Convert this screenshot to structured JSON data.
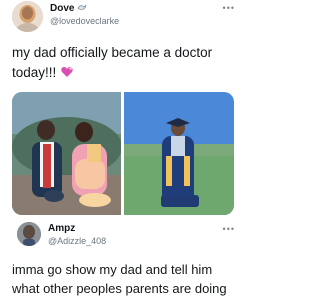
{
  "post": {
    "author_name": "Dove",
    "author_handle": "@lovedoveclarke",
    "more_icon": "more-icon",
    "text": "my dad officially became a doctor today!!!",
    "emoji": "heart-emoji",
    "images": [
      {
        "description_icon": "photo-dad-and-daughter"
      },
      {
        "description_icon": "photo-graduation"
      }
    ]
  },
  "reply": {
    "author_name": "Ampz",
    "author_handle": "@Adizzle_408",
    "more_icon": "more-icon",
    "line1": "imma go show my dad and tell him",
    "line2": "what other peoples parents are doing"
  },
  "colors": {
    "text": "#14171a",
    "secondary": "#6b7680",
    "heart": "#d94fb1"
  }
}
